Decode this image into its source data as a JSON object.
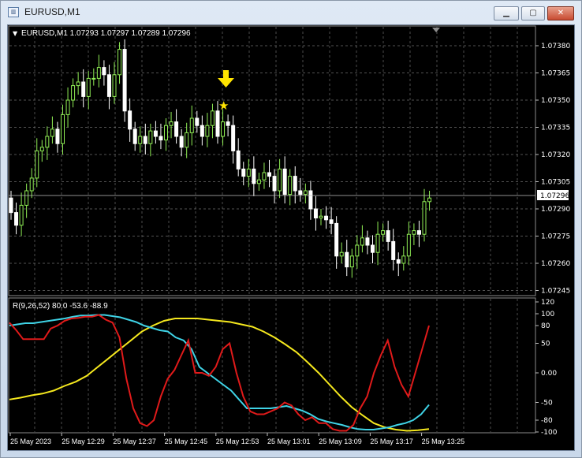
{
  "window": {
    "title": "EURUSD,M1",
    "icon": "chart-window-icon",
    "buttons": [
      "minimize-icon",
      "maximize-icon",
      "close-icon"
    ]
  },
  "chart": {
    "header": "EURUSD,M1  1.07293 1.07297 1.07289 1.07296",
    "current_price": "1.07296",
    "price_ticks": [
      "1.07380",
      "1.07365",
      "1.07350",
      "1.07335",
      "1.07320",
      "1.07305",
      "1.07290",
      "1.07275",
      "1.07260",
      "1.07245"
    ],
    "indicator_header": "R(9,26,52) 80.0 -53.6 -88.9",
    "indicator_ticks": [
      "120",
      "100",
      "80",
      "50",
      "0.00",
      "-50",
      "-80",
      "-100"
    ],
    "time_labels": [
      "25 May 2023",
      "25 May 12:29",
      "25 May 12:37",
      "25 May 12:45",
      "25 May 12:53",
      "25 May 13:01",
      "25 May 13:09",
      "25 May 13:17",
      "25 May 13:25"
    ],
    "colors": {
      "bull": "#90ee55",
      "bear": "#ffffff",
      "grid": "#6e6e6e",
      "red": "#e01a1a",
      "cyan": "#3fd3e6",
      "yellow": "#f5e81e",
      "arrow": "#ffe400"
    }
  }
}
